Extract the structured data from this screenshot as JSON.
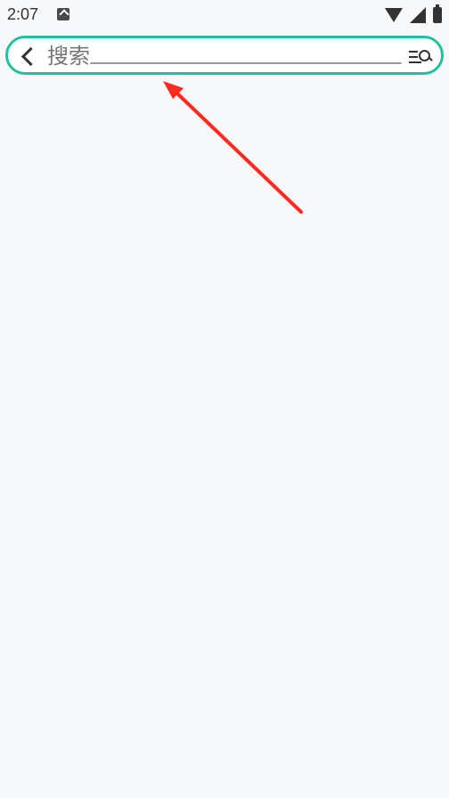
{
  "status": {
    "time": "2:07"
  },
  "search": {
    "placeholder": "搜索",
    "value": ""
  },
  "icons": {
    "back": "back-icon",
    "filter_search": "filter-search-icon",
    "notification": "notification-icon",
    "wifi": "wifi-icon",
    "signal": "signal-icon",
    "battery": "battery-icon"
  },
  "colors": {
    "accent": "#22c2a0",
    "background": "#f6f8fa",
    "annotation": "#ff2a1f"
  }
}
